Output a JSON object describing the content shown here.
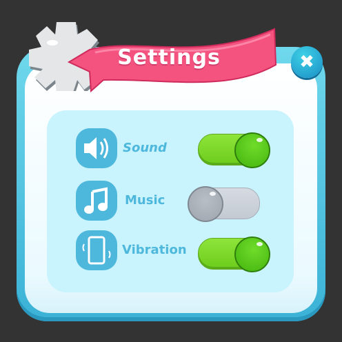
{
  "dialog": {
    "title": "Settings",
    "close_icon": "close-icon"
  },
  "colors": {
    "frame": "#4db8dc",
    "banner": "#f5537f",
    "panel": "#c9f3fd",
    "toggle_on": "#7ad82a",
    "toggle_off": "#c9ced6"
  },
  "settings": [
    {
      "label": "Sound",
      "icon": "speaker-icon",
      "enabled": true
    },
    {
      "label": "Music",
      "icon": "music-note-icon",
      "enabled": false
    },
    {
      "label": "Vibration",
      "icon": "phone-vibrate-icon",
      "enabled": true
    }
  ]
}
